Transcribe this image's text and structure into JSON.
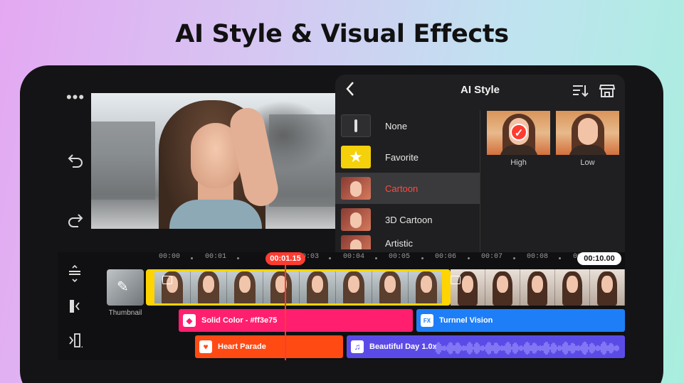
{
  "headline": "AI Style & Visual Effects",
  "left_controls": [
    "more-icon",
    "undo-icon",
    "redo-icon"
  ],
  "panel": {
    "title": "AI Style",
    "styles": [
      {
        "label": "None",
        "thumb": "none"
      },
      {
        "label": "Favorite",
        "thumb": "star-icon"
      },
      {
        "label": "Cartoon",
        "thumb": "portrait",
        "selected": true
      },
      {
        "label": "3D Cartoon",
        "thumb": "portrait"
      },
      {
        "label": "Artistic",
        "thumb": "portrait"
      }
    ],
    "levels": [
      {
        "label": "High",
        "selected": true
      },
      {
        "label": "Low",
        "selected": false
      }
    ]
  },
  "timeline": {
    "ruler": [
      "00:00",
      "00:01",
      "00:03",
      "00:04",
      "00:05",
      "00:06",
      "00:07",
      "00:08"
    ],
    "playhead_time": "00:01.15",
    "duration": "00:10.00",
    "thumbnail_label": "Thumbnail",
    "tracks": [
      {
        "label": "Solid Color - #ff3e75",
        "color": "#ff1f6e",
        "icon": "bucket-icon"
      },
      {
        "label": "Turnnel Vision",
        "color": "#1e7ef7",
        "icon": "fx-icon",
        "icon_text": "FX"
      },
      {
        "label": "Heart Parade",
        "color": "#ff4a14",
        "icon": "heart-icon"
      },
      {
        "label": "Beautiful Day 1.0x",
        "color": "#5b4be6",
        "icon": "music-icon"
      }
    ]
  },
  "colors": {
    "accent": "#ff3b30",
    "selection": "#ffd400"
  }
}
